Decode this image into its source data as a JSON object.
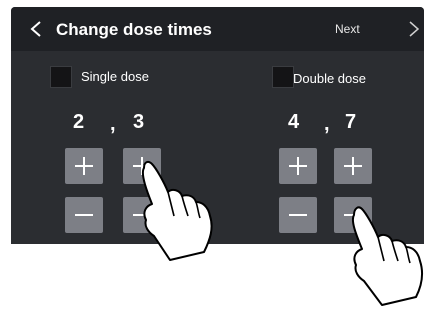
{
  "header": {
    "title": "Change dose times",
    "next_label": "Next"
  },
  "options": {
    "single": {
      "label": "Single dose",
      "first": "2",
      "separator": ",",
      "second": "3"
    },
    "double": {
      "label": "Double dose",
      "first": "4",
      "separator": ",",
      "second": "7"
    }
  },
  "icons": {
    "back": "chevron-left-icon",
    "next": "chevron-right-icon",
    "plus": "plus-icon",
    "minus": "minus-icon",
    "hand": "pointing-hand-icon"
  },
  "colors": {
    "screen_bg": "#2b2d31",
    "header_bg": "#1f2125",
    "button_bg": "#7d7f86",
    "text": "#ffffff"
  }
}
